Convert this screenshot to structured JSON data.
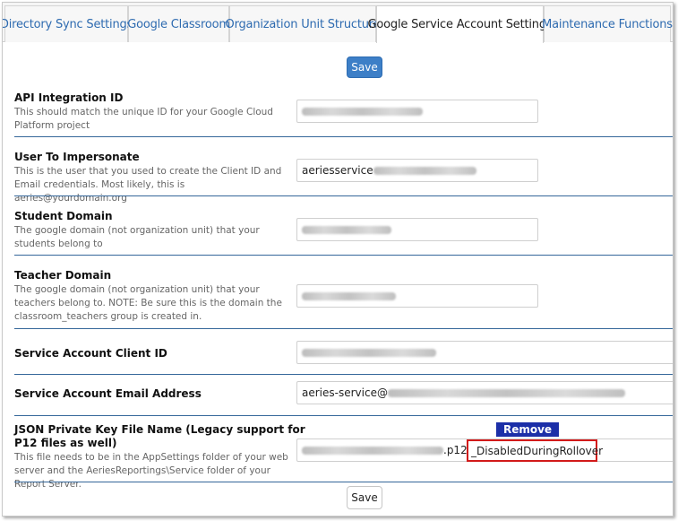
{
  "tabs": [
    {
      "label": "Directory Sync Settings",
      "active": false
    },
    {
      "label": "Google Classroom",
      "active": false
    },
    {
      "label": "Organization Unit Structure",
      "active": false
    },
    {
      "label": "Google Service Account Settings",
      "active": true
    },
    {
      "label": "Maintenance Functions",
      "active": false
    }
  ],
  "save_top_label": "Save",
  "save_bottom_label": "Save",
  "fields": {
    "api_integration_id": {
      "label": "API Integration ID",
      "description": "This should match the unique ID for your Google Cloud Platform project"
    },
    "user_to_impersonate": {
      "label": "User To Impersonate",
      "description": "This is the user that you used to create the Client ID and Email credentials. Most likely, this is aeries@yourdomain.org",
      "value_prefix": "aeriesservice"
    },
    "student_domain": {
      "label": "Student Domain",
      "description": "The google domain (not organization unit) that your students belong to"
    },
    "teacher_domain": {
      "label": "Teacher Domain",
      "description": "The google domain (not organization unit) that your teachers belong to. NOTE: Be sure this is the domain the classroom_teachers group is created in."
    },
    "service_account_client_id": {
      "label": "Service Account Client ID"
    },
    "service_account_email": {
      "label": "Service Account Email Address",
      "value_prefix": "aeries-service@"
    },
    "json_key_file": {
      "label": "JSON Private Key File Name (Legacy support for P12 files as well)",
      "description": "This file needs to be in the AppSettings folder of your web server and the AeriesReportings\\Service folder of your Report Server.",
      "value_suffix": ".p12",
      "highlight_value": "_DisabledDuringRollover",
      "highlight_color": "#d21a1a"
    }
  },
  "annotation": {
    "remove_label": "Remove",
    "color": "#1c2fa8"
  },
  "colors": {
    "tab_link": "#2e6bb0",
    "primary_button": "#3d7fc7",
    "separator": "#35679a"
  }
}
